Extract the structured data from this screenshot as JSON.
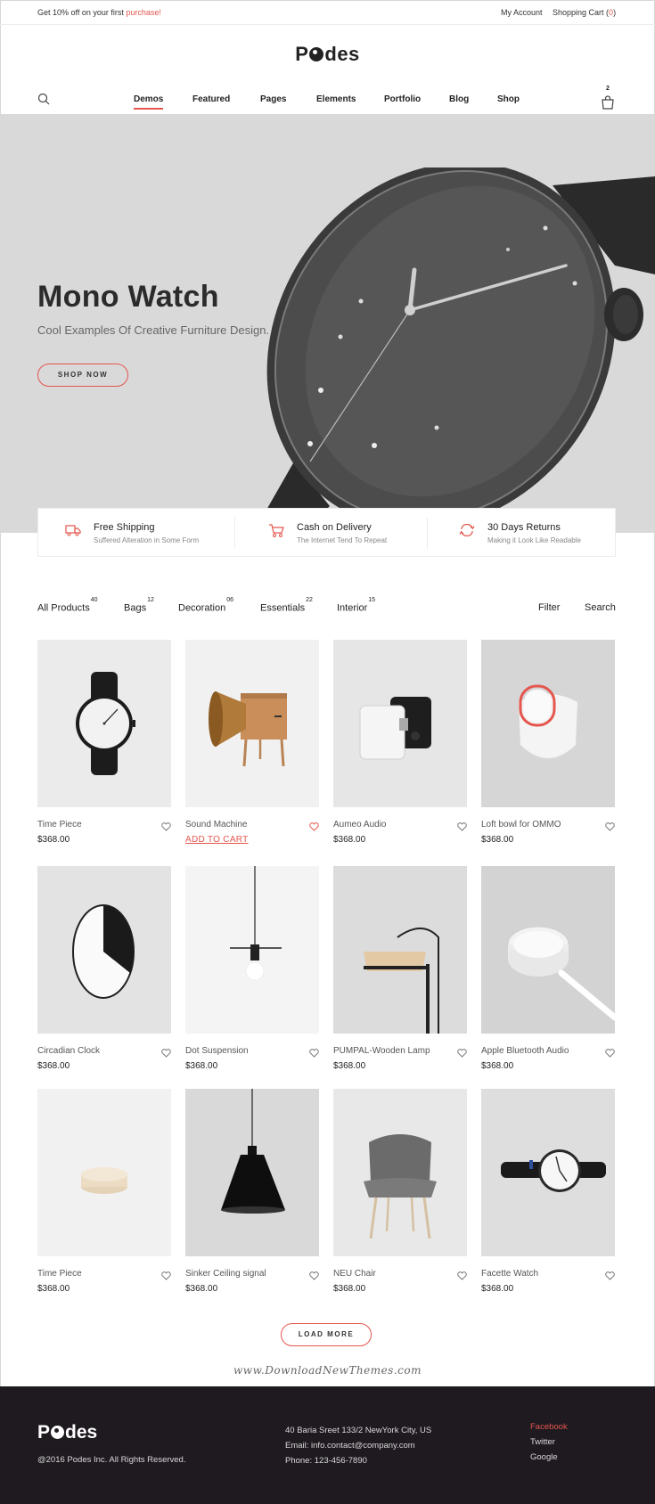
{
  "topbar": {
    "promo_prefix": "Get 10% off on your first ",
    "promo_link": "purchase",
    "promo_suffix": "!",
    "my_account": "My Account",
    "shopping_cart": "Shopping Cart",
    "cart_count": "0"
  },
  "brand": {
    "logo_p": "P",
    "logo_rest": "des"
  },
  "nav": {
    "items": [
      "Demos",
      "Featured",
      "Pages",
      "Elements",
      "Portfolio",
      "Blog",
      "Shop"
    ],
    "active": "Demos",
    "bag_count": "2",
    "icons": [
      "search-icon",
      "shopping-bag-icon"
    ]
  },
  "hero": {
    "title": "Mono Watch",
    "subtitle": "Cool Examples Of Creative Furniture Design.",
    "button": "SHOP NOW"
  },
  "features": [
    {
      "title": "Free Shipping",
      "subtitle": "Suffered Alteration in Some Form",
      "icon": "truck-icon"
    },
    {
      "title": "Cash on Delivery",
      "subtitle": "The Internet Tend To Repeat",
      "icon": "cart-icon"
    },
    {
      "title": "30 Days Returns",
      "subtitle": "Making it Look Like Readable",
      "icon": "return-icon"
    }
  ],
  "filters": {
    "categories": [
      {
        "label": "All Products",
        "count": "40"
      },
      {
        "label": "Bags",
        "count": "12"
      },
      {
        "label": "Decoration",
        "count": "06"
      },
      {
        "label": "Essentials",
        "count": "22"
      },
      {
        "label": "Interior",
        "count": "15"
      }
    ],
    "filter_label": "Filter",
    "search_label": "Search"
  },
  "products": [
    {
      "name": "Time Piece",
      "price": "$368.00"
    },
    {
      "name": "Sound Machine",
      "price": "$368.00",
      "action": "ADD TO CART",
      "hovered": true
    },
    {
      "name": "Aumeo Audio",
      "price": "$368.00"
    },
    {
      "name": "Loft bowl for OMMO",
      "price": "$368.00"
    },
    {
      "name": "Circadian Clock",
      "price": "$368.00"
    },
    {
      "name": "Dot Suspension",
      "price": "$368.00"
    },
    {
      "name": "PUMPAL-Wooden Lamp",
      "price": "$368.00"
    },
    {
      "name": "Apple Bluetooth Audio",
      "price": "$368.00"
    },
    {
      "name": "Time Piece",
      "price": "$368.00"
    },
    {
      "name": "Sinker Ceiling signal",
      "price": "$368.00"
    },
    {
      "name": "NEU Chair",
      "price": "$368.00"
    },
    {
      "name": "Facette Watch",
      "price": "$368.00"
    }
  ],
  "load_more": "LOAD MORE",
  "watermark": "www.DownloadNewThemes.com",
  "footer": {
    "copyright": "@2016 Podes Inc. All Rights Reserved.",
    "address": "40 Baria Sreet 133/2 NewYork City, US",
    "email": "Email: info.contact@company.com",
    "phone": "Phone: 123-456-7890",
    "social": [
      "Facebook",
      "Twitter",
      "Google"
    ]
  },
  "colors": {
    "accent": "#e4564e",
    "footer_bg": "#1f1a20",
    "hero_bg": "#d9d9d9"
  }
}
